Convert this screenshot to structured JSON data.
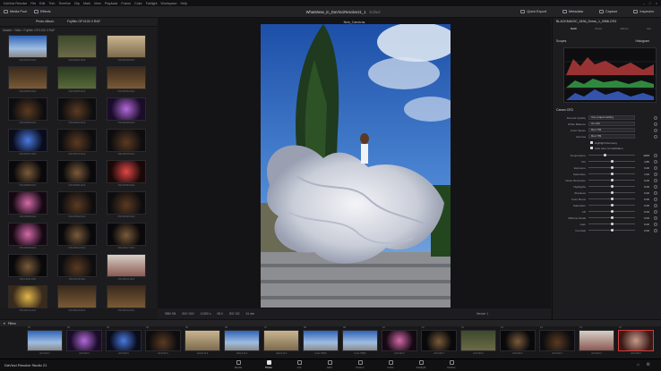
{
  "menubar": {
    "items": [
      "DaVinci Resolve",
      "File",
      "Edit",
      "Trim",
      "Timeline",
      "Clip",
      "Mark",
      "View",
      "Playback",
      "Fusion",
      "Color",
      "Fairlight",
      "Workspace",
      "Help"
    ]
  },
  "toolbar": {
    "left": [
      "Media Pool",
      "Effects"
    ],
    "project_title": "WhatsNew_in_DaVinciResolve21_1",
    "edited": "Edited",
    "right": [
      "Quick Export",
      "Metadata",
      "Capture",
      "Inspector"
    ]
  },
  "subbar": {
    "album": "Photo Album",
    "folder": "Fujifilm GFX100 II RAF",
    "zoom": "13%",
    "clip_name": "New_Cameras",
    "file": "BLACKMAGIC_0436_Dress_1_0086.CR3"
  },
  "browser": {
    "breadcrumb": "Master › Stills › Fujifilm GFX100 II RAF",
    "thumbs": [
      {
        "cap": "DSCF9010.RAF",
        "style": "sky"
      },
      {
        "cap": "DSCF8021.RAF",
        "style": "green"
      },
      {
        "cap": "DSCF8028.RAF",
        "style": "sand"
      },
      {
        "cap": "DSCF8054.RAF",
        "style": "warm"
      },
      {
        "cap": "DSCF8055.RAF",
        "style": "tree"
      },
      {
        "cap": "DSCF8052.RAF",
        "style": "warm"
      },
      {
        "cap": "DSCF8059.RAF",
        "style": "dark"
      },
      {
        "cap": "DSCF8063.RAF",
        "style": "dark"
      },
      {
        "cap": "DSCF8068.RAF",
        "style": "purple"
      },
      {
        "cap": "DSCF8071.RAF",
        "style": "blue"
      },
      {
        "cap": "DSCF8072.RAF",
        "style": "dark"
      },
      {
        "cap": "DSCF8076.RAF",
        "style": "dark"
      },
      {
        "cap": "DSCF8080.RAF",
        "style": "night"
      },
      {
        "cap": "DSCF8081.RAF",
        "style": "night"
      },
      {
        "cap": "DSCF8083.RAF",
        "style": "red"
      },
      {
        "cap": "DSCF8089.RAF",
        "style": "pink"
      },
      {
        "cap": "DSCF8092.RAF",
        "style": "dark"
      },
      {
        "cap": "DSCF8095.RAF",
        "style": "dark"
      },
      {
        "cap": "DSCF8098.RAF",
        "style": "pink"
      },
      {
        "cap": "DSCF8102.RAF",
        "style": "night"
      },
      {
        "cap": "DSCF8107.RAF",
        "style": "night"
      },
      {
        "cap": "DSCF8111.RAF",
        "style": "night"
      },
      {
        "cap": "DSCF8115.RAF",
        "style": "dark"
      },
      {
        "cap": "DSCF8121.RAF",
        "style": "city"
      },
      {
        "cap": "DSCF8124.RAF",
        "style": "food"
      },
      {
        "cap": "DSCF8129.RAF",
        "style": "warm"
      },
      {
        "cap": "DSCF8130.RAF",
        "style": "warm"
      }
    ]
  },
  "viewer_bottom": {
    "items": [
      "9550 KB",
      "500 / 500",
      "11/200 s",
      "f/8.0",
      "ISO 100",
      "24 mm"
    ],
    "version": "Version 1"
  },
  "inspector": {
    "title": "BLACKMAGIC_0436_Dress_1_0086.CR3",
    "tabs": [
      {
        "label": "RAW",
        "on": true
      },
      {
        "label": "Photo",
        "on": false
      },
      {
        "label": "Effects",
        "on": false
      },
      {
        "label": "File",
        "on": false
      }
    ],
    "scopes_label": "Scopes",
    "scope_type": "Histogram",
    "raw_header": "Canon CR3",
    "selects": [
      {
        "label": "Decode Quality",
        "value": "Use project setting"
      },
      {
        "label": "White Balance",
        "value": "As shot"
      },
      {
        "label": "Color Space",
        "value": "Rec.709"
      },
      {
        "label": "Gamma",
        "value": "Rec.709"
      }
    ],
    "checks": [
      "Highlight Recovery",
      "Auto tone normalization"
    ],
    "sliders": [
      {
        "label": "Temperature",
        "value": "4205",
        "pos": 0.35
      },
      {
        "label": "Tint",
        "value": "4.85",
        "pos": 0.52
      },
      {
        "label": "Exposure",
        "value": "0.00",
        "pos": 0.5
      },
      {
        "label": "Saturation",
        "value": "1.00",
        "pos": 0.5
      },
      {
        "label": "Noise Reduction",
        "value": "0.00",
        "pos": 0.5
      },
      {
        "label": "Highlights",
        "value": "0.00",
        "pos": 0.5
      },
      {
        "label": "Shadows",
        "value": "0.00",
        "pos": 0.5
      },
      {
        "label": "Color Boost",
        "value": "0.00",
        "pos": 0.5
      },
      {
        "label": "Saturation",
        "value": "0.00",
        "pos": 0.5
      },
      {
        "label": "Lift",
        "value": "0.00",
        "pos": 0.5
      },
      {
        "label": "Midtone Detail",
        "value": "0.00",
        "pos": 0.5
      },
      {
        "label": "Gain",
        "value": "0.00",
        "pos": 0.5
      },
      {
        "label": "Contrast",
        "value": "0.00",
        "pos": 0.5
      }
    ]
  },
  "filmstrip": {
    "label": "Filters",
    "thumbs": [
      {
        "num": "01",
        "cap": "GFX100 II",
        "style": "sky"
      },
      {
        "num": "02",
        "cap": "GFX100 II",
        "style": "purple"
      },
      {
        "num": "03",
        "cap": "GFX100 II",
        "style": "blue"
      },
      {
        "num": "04",
        "cap": "GFX100 II",
        "style": "dark"
      },
      {
        "num": "05",
        "cap": "LEICA SL3",
        "style": "sand"
      },
      {
        "num": "06",
        "cap": "LEICA SL3",
        "style": "sky"
      },
      {
        "num": "07",
        "cap": "LEICA SL3",
        "style": "sand"
      },
      {
        "num": "08",
        "cap": "ILCE-7RM5",
        "style": "sky"
      },
      {
        "num": "09",
        "cap": "ILCE-7RM5",
        "style": "sky"
      },
      {
        "num": "10",
        "cap": "GFX100 II",
        "style": "pink"
      },
      {
        "num": "11",
        "cap": "GFX100 II",
        "style": "night"
      },
      {
        "num": "12",
        "cap": "GFX100 II",
        "style": "green"
      },
      {
        "num": "13",
        "cap": "GFX100 II",
        "style": "night"
      },
      {
        "num": "14",
        "cap": "GFX100 II",
        "style": "dark"
      },
      {
        "num": "15",
        "cap": "GFX100 II",
        "style": "city"
      },
      {
        "num": "16",
        "cap": "GFX100 II",
        "style": "dress"
      }
    ]
  },
  "pagebar": {
    "brand": "DaVinci Resolve Studio 21",
    "pages": [
      {
        "label": "Media",
        "on": false
      },
      {
        "label": "Photo",
        "on": true
      },
      {
        "label": "Cut",
        "on": false
      },
      {
        "label": "Edit",
        "on": false
      },
      {
        "label": "Fusion",
        "on": false
      },
      {
        "label": "Color",
        "on": false
      },
      {
        "label": "Fairlight",
        "on": false
      },
      {
        "label": "Deliver",
        "on": false
      }
    ]
  },
  "colors": {
    "accent": "#d23b3b",
    "panel": "#1d1d20",
    "bg": "#1a1a1c"
  }
}
